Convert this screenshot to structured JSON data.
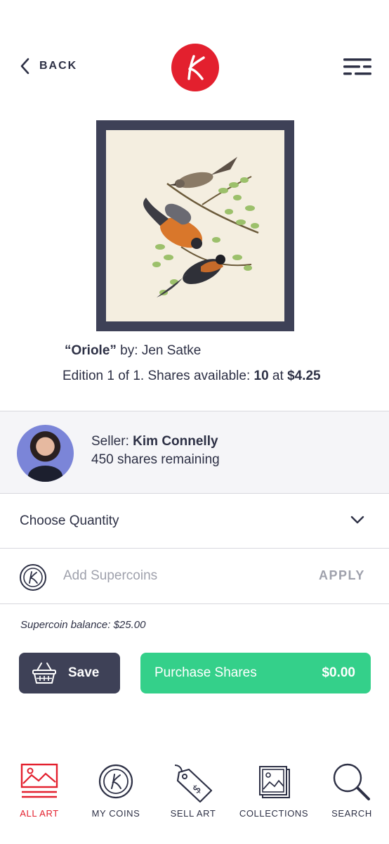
{
  "header": {
    "back_label": "BACK",
    "logo_letter": "K"
  },
  "artwork": {
    "title": "“Oriole”",
    "by_label": " by: ",
    "artist": "Jen Satke",
    "edition_text": "Edition 1 of 1. Shares available: ",
    "shares_available": "10",
    "at_text": " at ",
    "price": "$4.25"
  },
  "seller": {
    "label": "Seller: ",
    "name": "Kim Connelly",
    "remaining": "450 shares remaining"
  },
  "quantity": {
    "label": "Choose Quantity"
  },
  "supercoins": {
    "placeholder": "Add Supercoins",
    "apply_label": "APPLY",
    "balance_text": "Supercoin balance: $25.00"
  },
  "actions": {
    "save_label": "Save",
    "purchase_label": "Purchase Shares",
    "purchase_total": "$0.00"
  },
  "tabbar": {
    "tabs": [
      {
        "label": "ALL ART",
        "icon": "image-icon",
        "active": true
      },
      {
        "label": "MY COINS",
        "icon": "coin-icon",
        "active": false
      },
      {
        "label": "SELL ART",
        "icon": "price-tag-icon",
        "active": false
      },
      {
        "label": "COLLECTIONS",
        "icon": "collections-icon",
        "active": false
      },
      {
        "label": "SEARCH",
        "icon": "search-icon",
        "active": false
      }
    ]
  },
  "colors": {
    "brand_red": "#e3202e",
    "dark_navy": "#3e4157",
    "purchase_green": "#34d08a",
    "muted_gray": "#9fa1ac"
  }
}
